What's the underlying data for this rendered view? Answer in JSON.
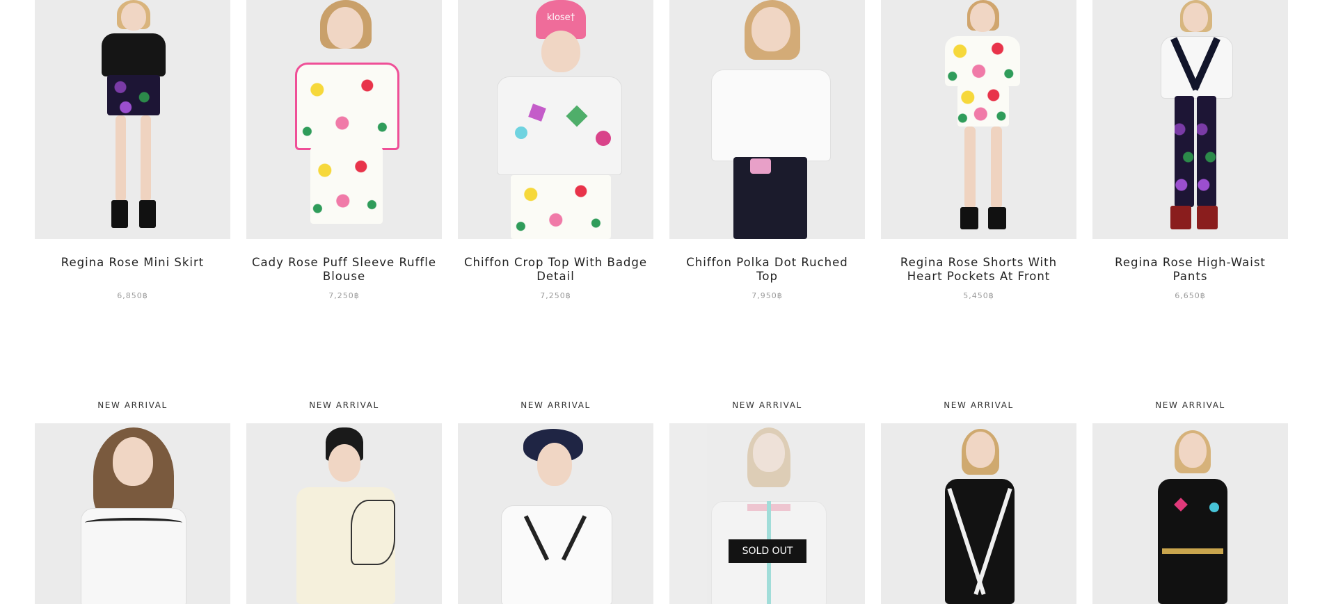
{
  "products_row1": [
    {
      "title": "Regina Rose Mini Skirt",
      "price": "6,850฿"
    },
    {
      "title": "Cady Rose Puff Sleeve Ruffle Blouse",
      "price": "7,250฿"
    },
    {
      "title": "Chiffon Crop Top With Badge Detail",
      "price": "7,250฿"
    },
    {
      "title": "Chiffon Polka Dot Ruched Top",
      "price": "7,950฿"
    },
    {
      "title": "Regina Rose Shorts With Heart Pockets At Front",
      "price": "5,450฿"
    },
    {
      "title": "Regina Rose High-Waist Pants",
      "price": "6,650฿"
    }
  ],
  "products_row2": [
    {
      "badge": "NEW ARRIVAL"
    },
    {
      "badge": "NEW ARRIVAL"
    },
    {
      "badge": "NEW ARRIVAL"
    },
    {
      "badge": "NEW ARRIVAL",
      "status": "SOLD OUT"
    },
    {
      "badge": "NEW ARRIVAL"
    },
    {
      "badge": "NEW ARRIVAL"
    }
  ],
  "beanie_text": "klose†"
}
